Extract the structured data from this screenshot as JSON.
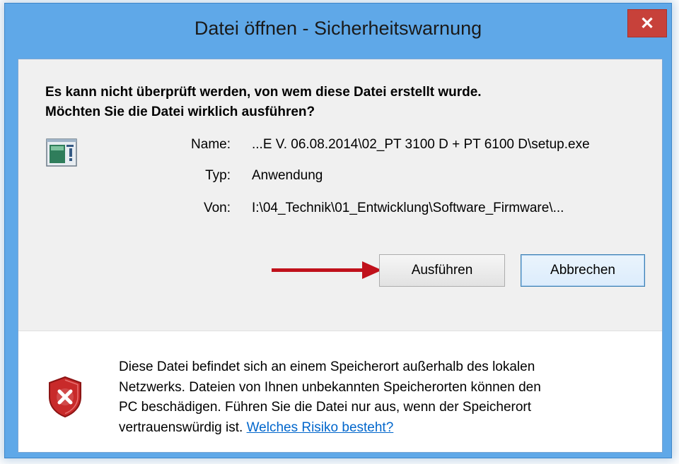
{
  "window": {
    "title": "Datei öffnen - Sicherheitswarnung",
    "close_label": "✕"
  },
  "question": {
    "line1": "Es kann nicht überprüft werden, von wem diese Datei erstellt wurde.",
    "line2": "Möchten Sie die Datei wirklich ausführen?"
  },
  "details": {
    "name_label": "Name:",
    "name_value": "...E V. 06.08.2014\\02_PT 3100 D + PT 6100 D\\setup.exe",
    "type_label": "Typ:",
    "type_value": "Anwendung",
    "from_label": "Von:",
    "from_value": "I:\\04_Technik\\01_Entwicklung\\Software_Firmware\\..."
  },
  "buttons": {
    "run": "Ausführen",
    "cancel": "Abbrechen"
  },
  "warning": {
    "line1": "Diese Datei befindet sich an einem Speicherort außerhalb des lokalen",
    "line2": "Netzwerks. Dateien von Ihnen unbekannten Speicherorten können den",
    "line3": "PC beschädigen. Führen Sie die Datei nur aus, wenn der Speicherort",
    "line4_text": "vertrauenswürdig ist. ",
    "link": "Welches Risiko besteht?"
  },
  "icons": {
    "app": "application-icon",
    "shield": "security-shield-error-icon",
    "annotation": "red-arrow-annotation"
  },
  "colors": {
    "titlebar": "#5fa8e8",
    "close_button": "#c7413a",
    "dialog_background": "#f0f0f0",
    "link": "#0066cc",
    "arrow": "#c0111b"
  }
}
